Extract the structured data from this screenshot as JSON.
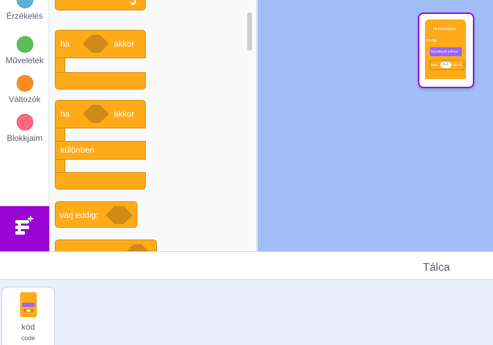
{
  "categories": [
    {
      "label": "Érzékelés",
      "color": "#5cb1d6"
    },
    {
      "label": "Műveletek",
      "color": "#59c059"
    },
    {
      "label": "Változók",
      "color": "#ff8c1a"
    },
    {
      "label": "Blokkjaim",
      "color": "#ff6680"
    }
  ],
  "blocks": {
    "if_then": {
      "ha": "ha",
      "akkor": "akkor"
    },
    "if_else": {
      "ha": "ha",
      "akkor": "akkor",
      "kulonben": "különben"
    },
    "wait_until": {
      "label": "várj eddig:"
    }
  },
  "sprite_preview": {
    "hat": "ha kattintáskor",
    "forever": "mindig",
    "next_costume": "következő jelmez",
    "wait_prefix": "várj",
    "wait_value": "0.2",
    "wait_suffix": "mp-et"
  },
  "talca": {
    "title": "Tálca",
    "item_name": "kód",
    "item_type": "code"
  },
  "colors": {
    "control": "#ffab19",
    "control_dark": "#cf8b17",
    "looks": "#9966ff",
    "extension": "#9b05d3",
    "stage": "#a1bef8"
  }
}
